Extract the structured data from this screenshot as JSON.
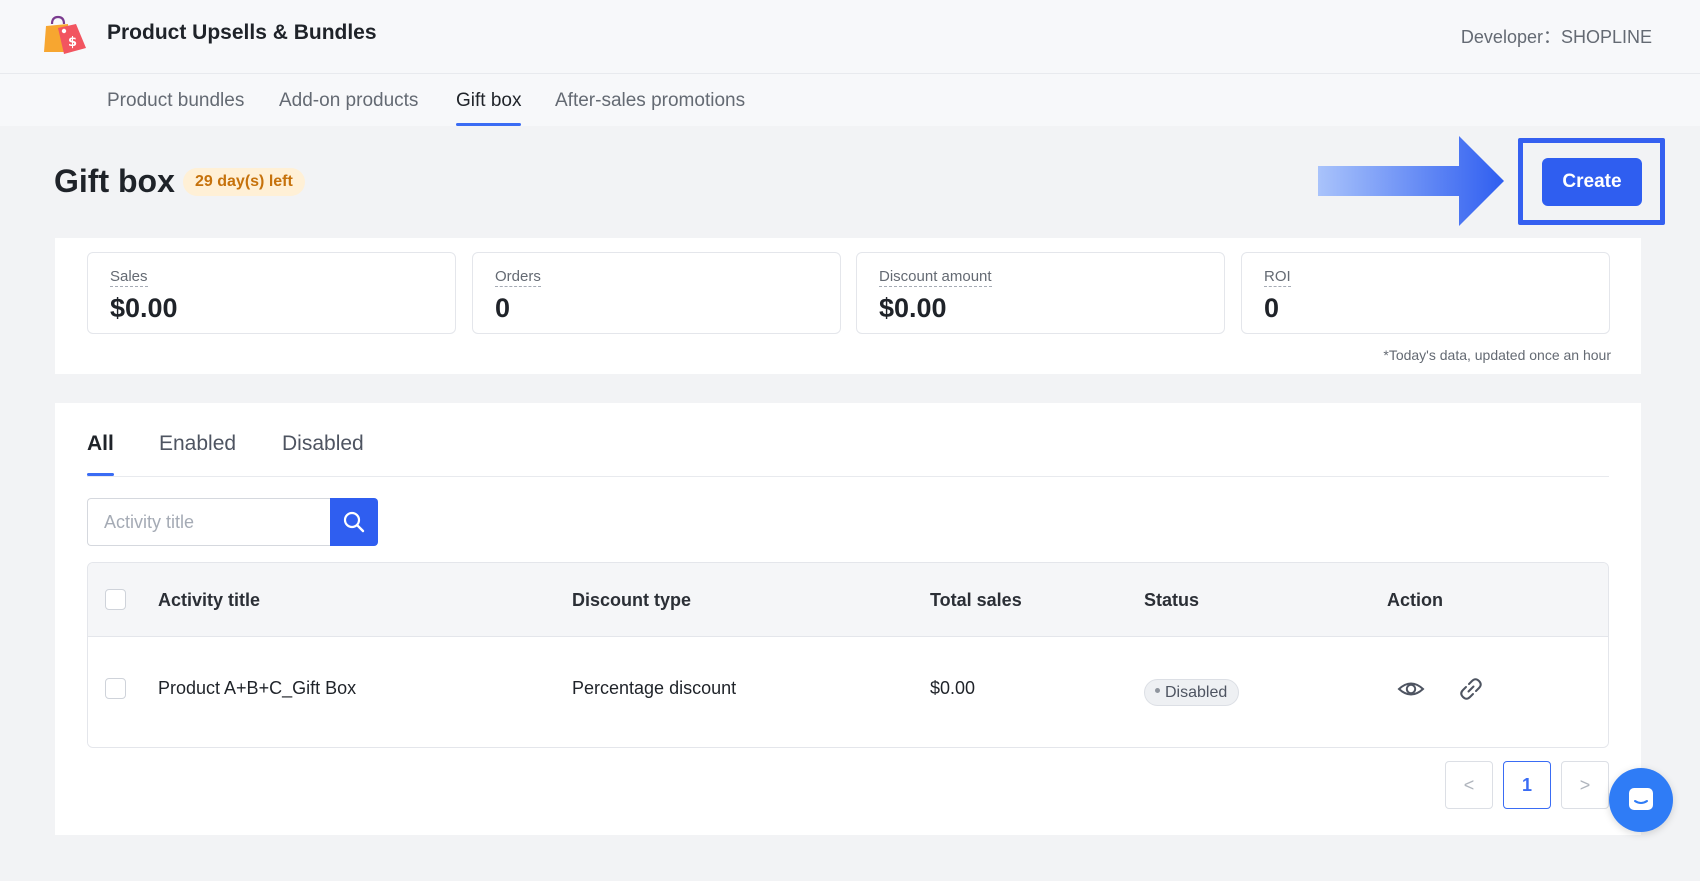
{
  "header": {
    "app_title": "Product Upsells & Bundles",
    "developer": "Developer：SHOPLINE",
    "logo_icon": "shopping-bag-price-tag-icon"
  },
  "nav": {
    "tabs": [
      {
        "label": "Product bundles",
        "active": false
      },
      {
        "label": "Add-on products",
        "active": false
      },
      {
        "label": "Gift box",
        "active": true
      },
      {
        "label": "After-sales promotions",
        "active": false
      }
    ]
  },
  "page": {
    "title": "Gift box",
    "trial_badge": "29 day(s) left",
    "create_label": "Create",
    "accent_color": "#2f5ef0"
  },
  "metrics": {
    "items": [
      {
        "label": "Sales",
        "value": "$0.00"
      },
      {
        "label": "Orders",
        "value": "0"
      },
      {
        "label": "Discount amount",
        "value": "$0.00"
      },
      {
        "label": "ROI",
        "value": "0"
      }
    ],
    "note": "*Today's data, updated once an hour"
  },
  "list": {
    "filter_tabs": [
      {
        "label": "All",
        "active": true
      },
      {
        "label": "Enabled",
        "active": false
      },
      {
        "label": "Disabled",
        "active": false
      }
    ],
    "search": {
      "placeholder": "Activity title",
      "value": ""
    },
    "columns": [
      "Activity title",
      "Discount type",
      "Total sales",
      "Status",
      "Action"
    ],
    "rows": [
      {
        "title": "Product A+B+C_Gift Box",
        "discount_type": "Percentage discount",
        "total_sales": "$0.00",
        "status": "Disabled",
        "actions": [
          "eye-icon",
          "link-icon"
        ]
      }
    ],
    "pagination": {
      "prev": "<",
      "current": "1",
      "next": ">"
    }
  },
  "chat": {
    "icon": "chat-bubble-icon"
  }
}
